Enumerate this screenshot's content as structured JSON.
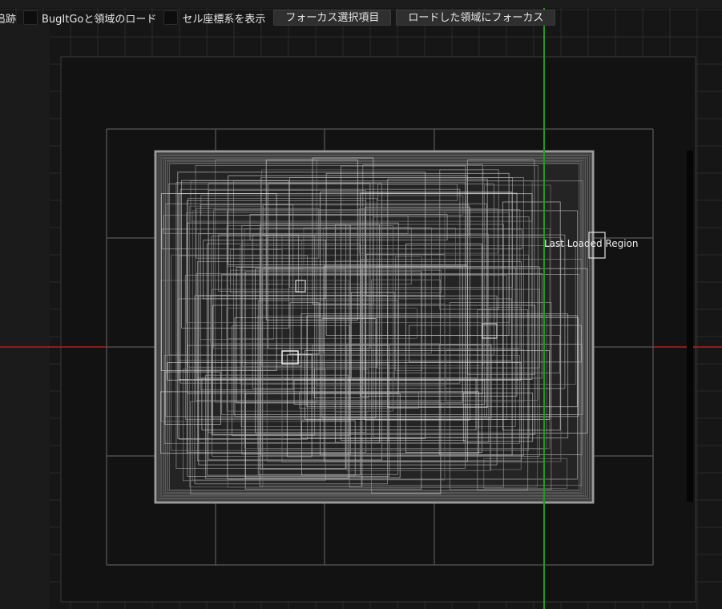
{
  "toolbar": {
    "trail_label": "追跡",
    "bugitgo_label": "BugItGoと領域のロード",
    "cell_coords_label": "セル座標系を表示",
    "focus_selected_button": "フォーカス選択項目",
    "focus_loaded_button": "ロードした領域にフォーカス"
  },
  "viewport": {
    "region_label": "Last Loaded Region",
    "colors": {
      "background": "#161616",
      "grid": "#2a2a2a",
      "cell_lines": "#5a5a5a",
      "x_axis": "#b02020",
      "y_axis": "#1f9a1f",
      "region_fill": "#242424",
      "region_outline": "#9a9a9a"
    },
    "icons": [
      "checkbox-icon"
    ]
  }
}
